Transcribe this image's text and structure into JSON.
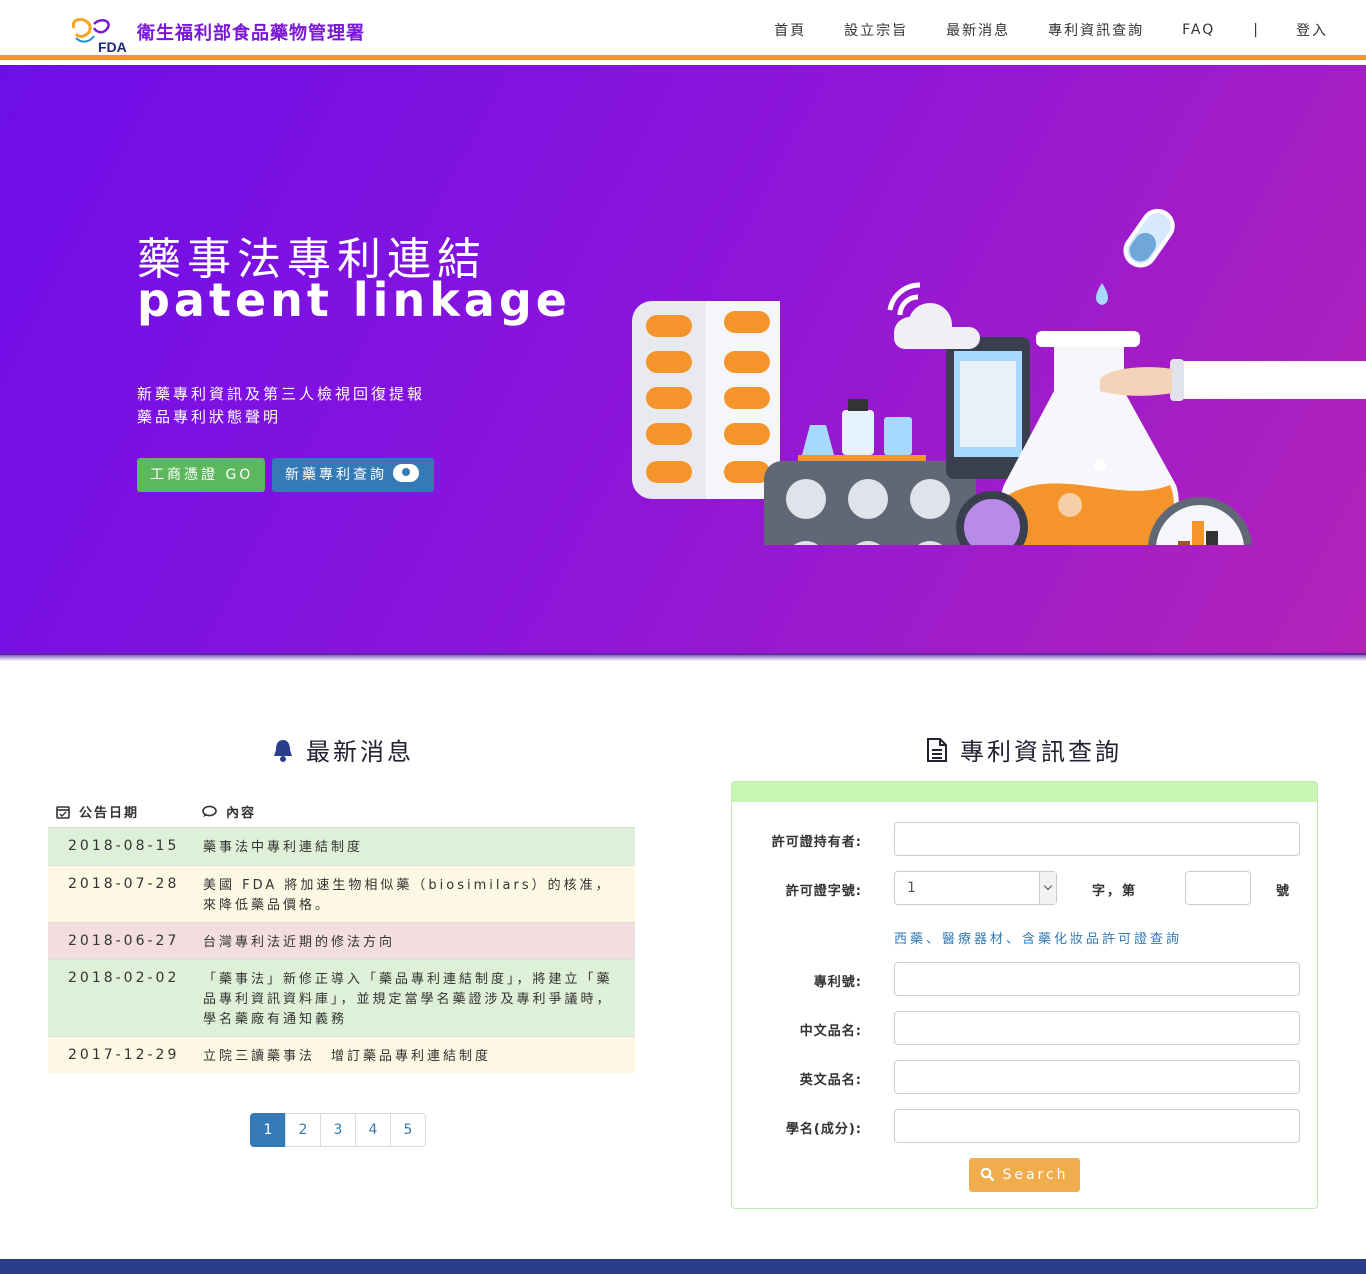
{
  "header": {
    "site_title": "衛生福利部食品藥物管理署",
    "logo_text": "FDA",
    "nav": [
      "首頁",
      "設立宗旨",
      "最新消息",
      "專利資訊查詢",
      "FAQ"
    ],
    "nav_separator": "|",
    "login_label": "登入"
  },
  "hero": {
    "title": "藥事法專利連結",
    "subtitle": "patent linkage",
    "desc_line1": "新藥專利資訊及第三人檢視回復提報",
    "desc_line2": "藥品專利狀態聲明",
    "btn_green": "工商憑證 GO",
    "btn_blue": "新藥專利查詢"
  },
  "news": {
    "title": "最新消息",
    "col_date": "公告日期",
    "col_content": "內容",
    "rows": [
      {
        "date": "2018-08-15",
        "text": "藥事法中專利連結制度",
        "tone": "green"
      },
      {
        "date": "2018-07-28",
        "text": "美國 FDA 將加速生物相似藥（biosimilars）的核准，來降低藥品價格。",
        "tone": "yellow"
      },
      {
        "date": "2018-06-27",
        "text": "台灣專利法近期的修法方向",
        "tone": "red"
      },
      {
        "date": "2018-02-02",
        "text": "「藥事法」新修正導入「藥品專利連結制度」，將建立「藥品專利資訊資料庫」，並規定當學名藥證涉及專利爭議時，學名藥廠有通知義務",
        "tone": "green"
      },
      {
        "date": "2017-12-29",
        "text": "立院三讀藥事法　增訂藥品專利連結制度",
        "tone": "yellow"
      }
    ],
    "pages": [
      "1",
      "2",
      "3",
      "4",
      "5"
    ]
  },
  "query": {
    "title": "專利資訊查詢",
    "label_holder": "許可證持有者:",
    "label_license": "許可證字號:",
    "license_select_value": "1",
    "license_mid": "字，第",
    "license_end": "號",
    "license_link": "西藥、醫療器材、含藥化妝品許可證查詢",
    "label_patent": "專利號:",
    "label_cname": "中文品名:",
    "label_ename": "英文品名:",
    "label_ingredient": "學名(成分):",
    "search_label": "Search"
  },
  "colors": {
    "accent_orange": "#f5942a",
    "brand_purple": "#7a18d6",
    "footer_navy": "#2a3e8c"
  }
}
